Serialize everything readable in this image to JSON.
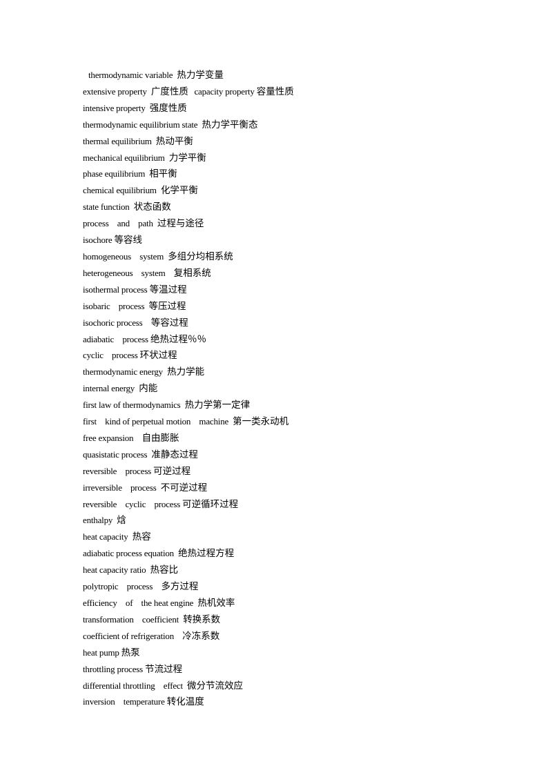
{
  "document": {
    "entries": [
      {
        "en": "thermodynamic variable  ",
        "zh": "热力学变量"
      },
      {
        "en": "extensive property  ",
        "zh": "广度性质  ",
        "en2": "capacity property ",
        "zh2": "容量性质"
      },
      {
        "en": "intensive property  ",
        "zh": "强度性质"
      },
      {
        "en": "thermodynamic equilibrium state  ",
        "zh": "热力学平衡态"
      },
      {
        "en": "thermal equilibrium  ",
        "zh": "热动平衡"
      },
      {
        "en": "mechanical equilibrium  ",
        "zh": "力学平衡"
      },
      {
        "en": "phase equilibrium  ",
        "zh": "相平衡"
      },
      {
        "en": "chemical equilibrium  ",
        "zh": "化学平衡"
      },
      {
        "en": "state function  ",
        "zh": "状态函数"
      },
      {
        "en": "process    and    path  ",
        "zh": "过程与途径"
      },
      {
        "en": "isochore ",
        "zh": "等容线"
      },
      {
        "en": "homogeneous    system  ",
        "zh": "多组分均相系统"
      },
      {
        "en": "heterogeneous    system    ",
        "zh": "复相系统"
      },
      {
        "en": "isothermal process ",
        "zh": "等温过程"
      },
      {
        "en": "isobaric    process  ",
        "zh": "等压过程"
      },
      {
        "en": "isochoric process    ",
        "zh": "等容过程"
      },
      {
        "en": "adiabatic    process ",
        "zh": "绝热过程％％"
      },
      {
        "en": "cyclic    process ",
        "zh": "环状过程"
      },
      {
        "en": "thermodynamic energy  ",
        "zh": "热力学能"
      },
      {
        "en": "internal energy  ",
        "zh": "内能"
      },
      {
        "en": "first law of thermodynamics  ",
        "zh": "热力学第一定律"
      },
      {
        "en": "first    kind of perpetual motion    machine  ",
        "zh": "第一类永动机"
      },
      {
        "en": "free expansion    ",
        "zh": "自由膨胀"
      },
      {
        "en": "quasistatic process  ",
        "zh": "准静态过程"
      },
      {
        "en": "reversible    process ",
        "zh": "可逆过程"
      },
      {
        "en": "irreversible    process  ",
        "zh": "不可逆过程"
      },
      {
        "en": "reversible    cyclic    process ",
        "zh": "可逆循环过程"
      },
      {
        "en": "enthalpy  ",
        "zh": "焓"
      },
      {
        "en": "heat capacity  ",
        "zh": "热容"
      },
      {
        "en": "adiabatic process equation  ",
        "zh": "绝热过程方程"
      },
      {
        "en": "heat capacity ratio  ",
        "zh": "热容比"
      },
      {
        "en": "polytropic    process    ",
        "zh": "多方过程"
      },
      {
        "en": "efficiency    of    the heat engine  ",
        "zh": "热机效率"
      },
      {
        "en": "transformation    coefficient  ",
        "zh": "转换系数"
      },
      {
        "en": "coefficient of refrigeration    ",
        "zh": "冷冻系数"
      },
      {
        "en": "heat pump ",
        "zh": "热泵"
      },
      {
        "en": "throttling process ",
        "zh": "节流过程"
      },
      {
        "en": "differential throttling    effect  ",
        "zh": "微分节流效应"
      },
      {
        "en": "inversion    temperature ",
        "zh": "转化温度"
      }
    ]
  }
}
